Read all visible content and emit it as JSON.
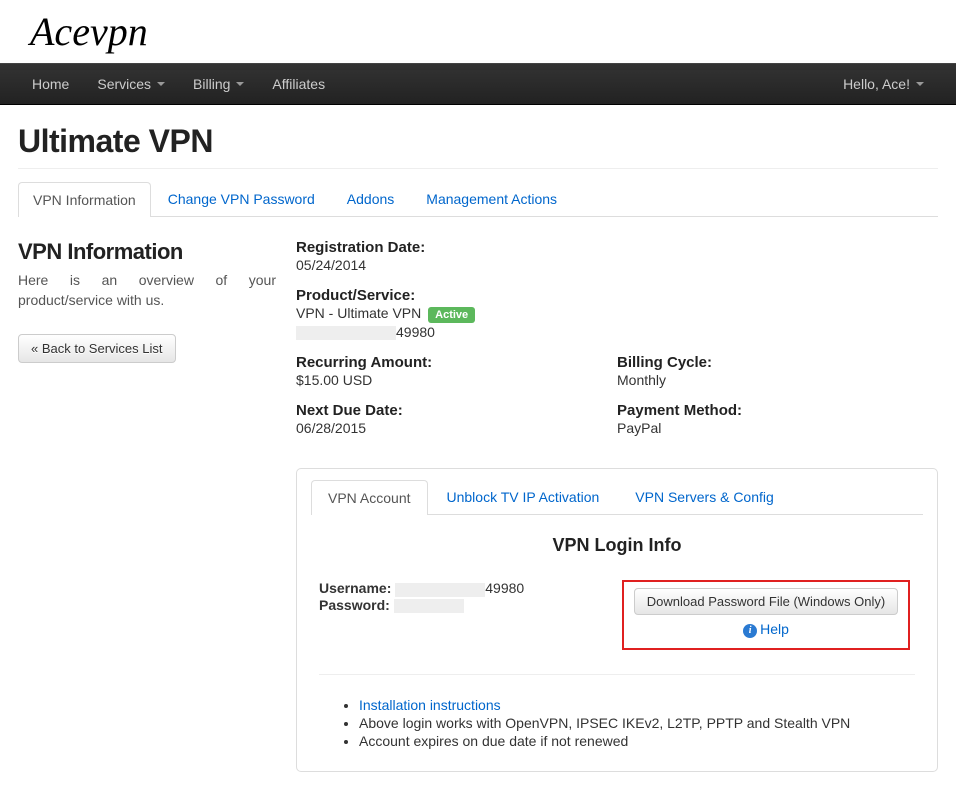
{
  "logo": "Acevpn",
  "nav": {
    "home": "Home",
    "services": "Services",
    "billing": "Billing",
    "affiliates": "Affiliates",
    "greeting": "Hello, Ace!"
  },
  "page_title": "Ultimate VPN",
  "tabs": {
    "vpn_info": "VPN Information",
    "change_pw": "Change VPN Password",
    "addons": "Addons",
    "mgmt": "Management Actions"
  },
  "sidebar": {
    "title": "VPN Information",
    "desc": "Here is an overview of your product/service with us.",
    "back_btn": "« Back to Services List"
  },
  "info": {
    "reg_label": "Registration Date:",
    "reg_value": "05/24/2014",
    "prod_label": "Product/Service:",
    "prod_value": "VPN - Ultimate VPN",
    "status_badge": "Active",
    "account_suffix": "49980",
    "recur_label": "Recurring Amount:",
    "recur_value": "$15.00 USD",
    "cycle_label": "Billing Cycle:",
    "cycle_value": "Monthly",
    "due_label": "Next Due Date:",
    "due_value": "06/28/2015",
    "pay_label": "Payment Method:",
    "pay_value": "PayPal"
  },
  "inner_tabs": {
    "account": "VPN Account",
    "unblock": "Unblock TV IP Activation",
    "servers": "VPN Servers & Config"
  },
  "login": {
    "title": "VPN Login Info",
    "username_label": "Username:",
    "username_suffix": "49980",
    "password_label": "Password:",
    "download_btn": "Download Password File (Windows Only)",
    "help": "Help"
  },
  "notes": {
    "install": "Installation instructions",
    "n2": "Above login works with OpenVPN, IPSEC IKEv2, L2TP, PPTP and Stealth VPN",
    "n3": "Account expires on due date if not renewed"
  }
}
